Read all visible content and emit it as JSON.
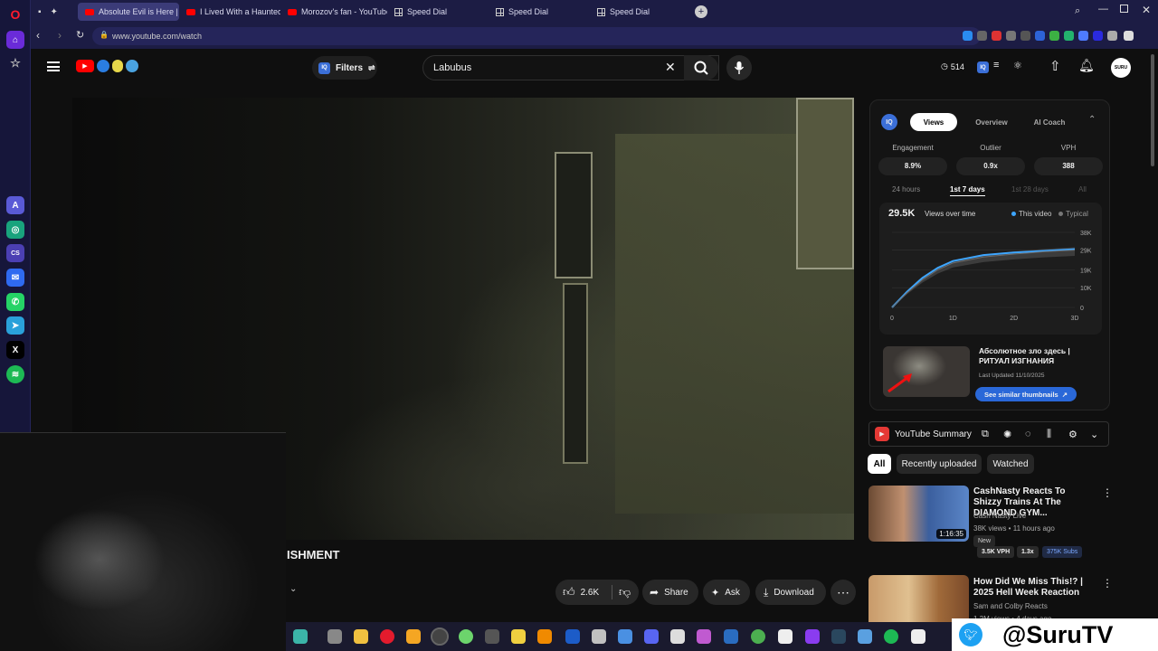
{
  "tabs": [
    {
      "label": "Absolute Evil is Here | R"
    },
    {
      "label": "I Lived With a Haunted Do"
    },
    {
      "label": "Morozov's fan - YouTube"
    },
    {
      "label": "Speed Dial"
    },
    {
      "label": "Speed Dial"
    },
    {
      "label": "Speed Dial"
    }
  ],
  "address": {
    "url": "www.youtube.com/watch"
  },
  "header": {
    "filters_label": "Filters",
    "search_value": "Labubus",
    "counter": "514",
    "avatar_label": "SURU",
    "iq_badge": "IQ"
  },
  "video": {
    "title_fragment": "ISHMENT",
    "likes": "2.6K",
    "share_label": "Share",
    "ask_label": "Ask",
    "download_label": "Download"
  },
  "iq_panel": {
    "tabs": [
      "Views",
      "Overview",
      "AI Coach"
    ],
    "metrics": [
      {
        "label": "Engagement",
        "value": "8.9%"
      },
      {
        "label": "Outlier",
        "value": "0.9x"
      },
      {
        "label": "VPH",
        "value": "388"
      }
    ],
    "ranges": [
      "24 hours",
      "1st 7 days",
      "1st 28 days",
      "All"
    ],
    "views_total": "29.5K",
    "views_label": "Views over time",
    "legend_this": "This video",
    "legend_typical": "Typical",
    "thumb_title": "Абсолютное зло здесь | РИТУАЛ ИЗГНАНИЯ",
    "last_updated": "Last Updated 11/10/2025",
    "similar_btn": "See similar thumbnails"
  },
  "chart_data": {
    "type": "line",
    "title": "Views over time",
    "x_ticks": [
      "0",
      "1D",
      "2D",
      "3D"
    ],
    "y_ticks": [
      "0",
      "10K",
      "19K",
      "29K",
      "38K"
    ],
    "ylim": [
      0,
      38000
    ],
    "xlim": [
      0,
      3
    ],
    "series": [
      {
        "name": "This video",
        "color": "#3ea6ff",
        "x": [
          0,
          0.25,
          0.5,
          0.75,
          1,
          1.5,
          2,
          2.5,
          3
        ],
        "y": [
          0,
          8000,
          15000,
          20000,
          23500,
          26500,
          27800,
          28600,
          29500
        ]
      },
      {
        "name": "Typical",
        "color": "#6b6b6b",
        "x": [
          0,
          0.25,
          0.5,
          0.75,
          1,
          1.5,
          2,
          2.5,
          3
        ],
        "y": [
          0,
          7500,
          14000,
          19000,
          22500,
          25500,
          27000,
          28200,
          29000
        ]
      }
    ]
  },
  "summary": {
    "label": "YouTube Summary"
  },
  "chips": [
    "All",
    "Recently uploaded",
    "Watched"
  ],
  "recommendations": [
    {
      "title": "CashNasty Reacts To Shizzy Trains At The DIAMOND GYM...",
      "channel": "Cash Nasty Live",
      "meta": "38K views • 11 hours ago",
      "badge": "New",
      "duration": "1:16:35",
      "vph": "3.5K VPH",
      "ratio": "1.3x",
      "subs": "375K Subs"
    },
    {
      "title": "How Did We Miss This!? | 2025 Hell Week Reaction",
      "channel": "Sam and Colby Reacts",
      "meta": "1.2M views • 4 days ago"
    }
  ],
  "overlay": {
    "handle": "@SuruTV"
  },
  "colors": {
    "accent": "#3ea6ff",
    "opera_bg": "#16163a",
    "yt_red": "#ff0000"
  }
}
